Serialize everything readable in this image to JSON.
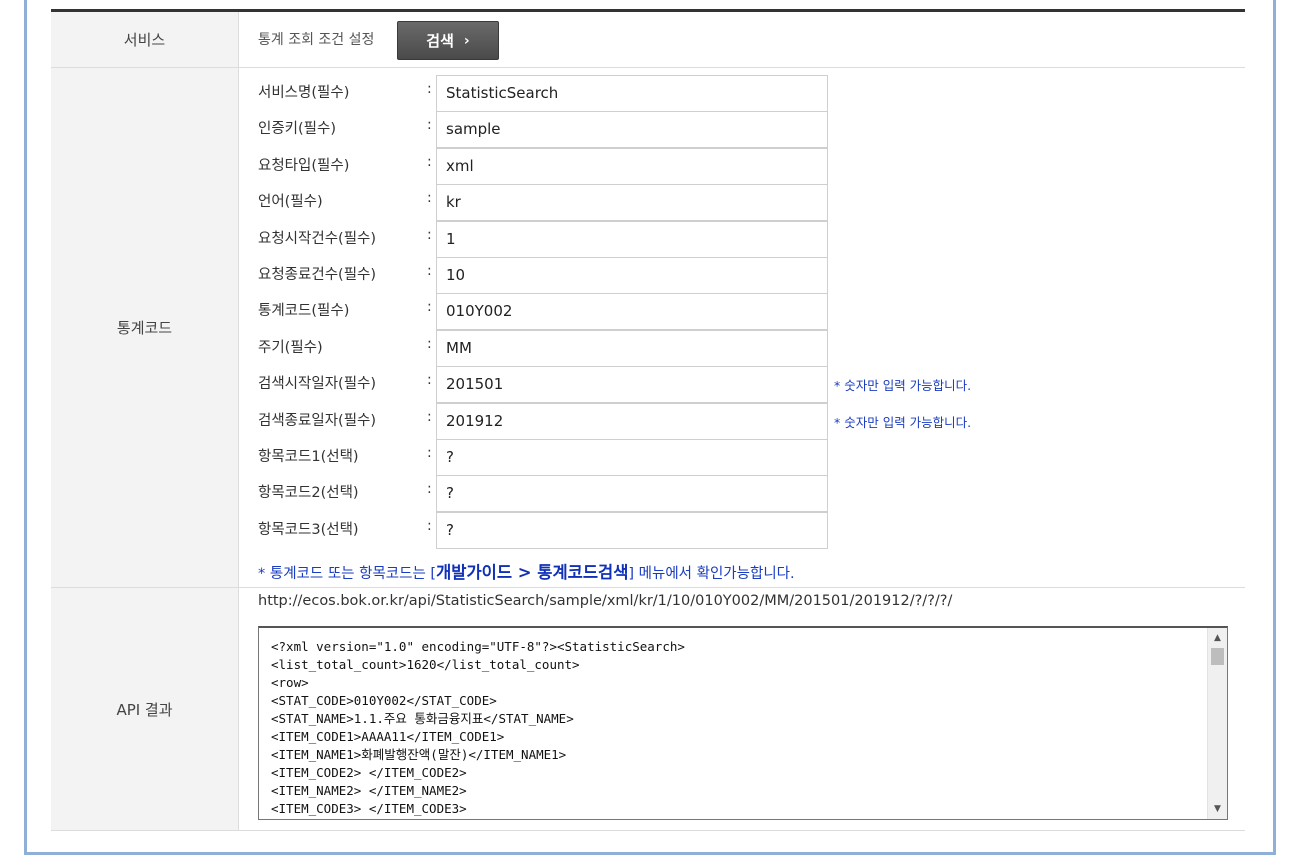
{
  "service": {
    "header": "서비스",
    "description": "통계 조회 조건 설정",
    "search_button": "검색",
    "chevron": "›"
  },
  "code_section": {
    "header": "통계코드",
    "params": [
      {
        "label": "서비스명(필수)",
        "value": "StatisticSearch"
      },
      {
        "label": "인증키(필수)",
        "value": "sample"
      },
      {
        "label": "요청타입(필수)",
        "value": "xml"
      },
      {
        "label": "언어(필수)",
        "value": "kr"
      },
      {
        "label": "요청시작건수(필수)",
        "value": "1"
      },
      {
        "label": "요청종료건수(필수)",
        "value": "10"
      },
      {
        "label": "통계코드(필수)",
        "value": "010Y002"
      },
      {
        "label": "주기(필수)",
        "value": "MM"
      },
      {
        "label": "검색시작일자(필수)",
        "value": "201501",
        "hint": "* 숫자만 입력 가능합니다."
      },
      {
        "label": "검색종료일자(필수)",
        "value": "201912",
        "hint": "* 숫자만 입력 가능합니다."
      },
      {
        "label": "항목코드1(선택)",
        "value": "?"
      },
      {
        "label": "항목코드2(선택)",
        "value": "?"
      },
      {
        "label": "항목코드3(선택)",
        "value": "?"
      }
    ],
    "colon": ":",
    "note_prefix": "* 통계코드 또는 항목코드는 [",
    "note_bold": "개발가이드 > 통계코드검색",
    "note_suffix": "] 메뉴에서 확인가능합니다."
  },
  "api": {
    "header": "API 결과",
    "url": "http://ecos.bok.or.kr/api/StatisticSearch/sample/xml/kr/1/10/010Y002/MM/201501/201912/?/?/?/",
    "result_lines": [
      "<?xml version=\"1.0\" encoding=\"UTF-8\"?><StatisticSearch>",
      "<list_total_count>1620</list_total_count>",
      "<row>",
      "<STAT_CODE>010Y002</STAT_CODE>",
      "<STAT_NAME>1.1.주요 통화금융지표</STAT_NAME>",
      "<ITEM_CODE1>AAAA11</ITEM_CODE1>",
      "<ITEM_NAME1>화폐발행잔액(말잔)</ITEM_NAME1>",
      "<ITEM_CODE2> </ITEM_CODE2>",
      "<ITEM_NAME2> </ITEM_NAME2>",
      "<ITEM_CODE3> </ITEM_CODE3>"
    ],
    "scroll_up": "▲",
    "scroll_down": "▼"
  }
}
